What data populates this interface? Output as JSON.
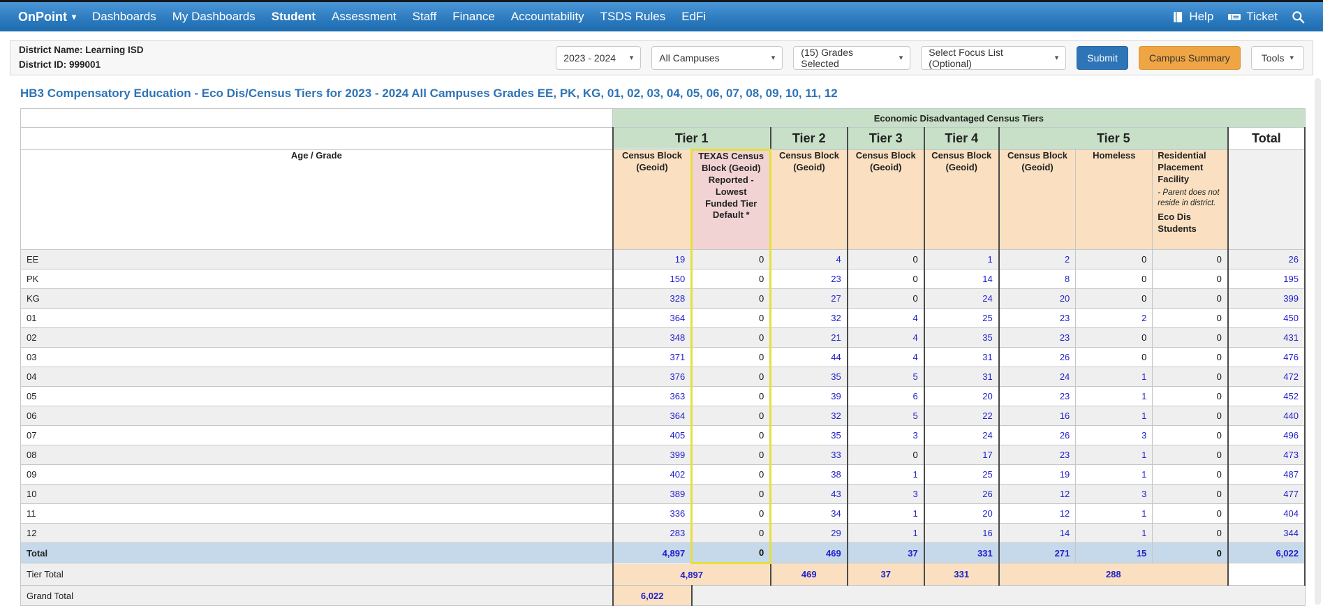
{
  "nav": {
    "brand": "OnPoint",
    "items": [
      {
        "label": "Dashboards",
        "active": false
      },
      {
        "label": "My Dashboards",
        "active": false
      },
      {
        "label": "Student",
        "active": true
      },
      {
        "label": "Assessment",
        "active": false
      },
      {
        "label": "Staff",
        "active": false
      },
      {
        "label": "Finance",
        "active": false
      },
      {
        "label": "Accountability",
        "active": false
      },
      {
        "label": "TSDS Rules",
        "active": false
      },
      {
        "label": "EdFi",
        "active": false
      }
    ],
    "help_label": "Help",
    "ticket_label": "Ticket"
  },
  "toolbar": {
    "district_name": "District Name: Learning ISD",
    "district_id": "District ID: 999001",
    "year_select": "2023 - 2024",
    "campus_select": "All Campuses",
    "grades_select": "(15) Grades Selected",
    "focus_select": "Select Focus List (Optional)",
    "submit_label": "Submit",
    "campus_summary_label": "Campus Summary",
    "tools_label": "Tools"
  },
  "page_title": "HB3 Compensatory Education - Eco Dis/Census Tiers for 2023 - 2024 All Campuses Grades EE, PK, KG, 01, 02, 03, 04, 05, 06, 07, 08, 09, 10, 11, 12",
  "table": {
    "banner": "Economic Disadvantaged Census Tiers",
    "age_grade_label": "Age / Grade",
    "tier_headers": [
      {
        "label": "Tier 1"
      },
      {
        "label": "Tier 2"
      },
      {
        "label": "Tier 3"
      },
      {
        "label": "Tier 4"
      },
      {
        "label": "Tier 5"
      },
      {
        "label": "Total"
      }
    ],
    "column_headers": {
      "census_block": "Census Block (Geoid)",
      "texas_census": "TEXAS Census Block (Geoid) Reported - Lowest Funded Tier Default *",
      "homeless": "Homeless",
      "residential_title": "Residential Placement Facility",
      "residential_note": "- Parent does not reside in district.",
      "residential_sub": "Eco Dis Students"
    },
    "rows": [
      {
        "label": "EE",
        "values": [
          "19",
          "0",
          "4",
          "0",
          "1",
          "2",
          "0",
          "0",
          "26"
        ]
      },
      {
        "label": "PK",
        "values": [
          "150",
          "0",
          "23",
          "0",
          "14",
          "8",
          "0",
          "0",
          "195"
        ]
      },
      {
        "label": "KG",
        "values": [
          "328",
          "0",
          "27",
          "0",
          "24",
          "20",
          "0",
          "0",
          "399"
        ]
      },
      {
        "label": "01",
        "values": [
          "364",
          "0",
          "32",
          "4",
          "25",
          "23",
          "2",
          "0",
          "450"
        ]
      },
      {
        "label": "02",
        "values": [
          "348",
          "0",
          "21",
          "4",
          "35",
          "23",
          "0",
          "0",
          "431"
        ]
      },
      {
        "label": "03",
        "values": [
          "371",
          "0",
          "44",
          "4",
          "31",
          "26",
          "0",
          "0",
          "476"
        ]
      },
      {
        "label": "04",
        "values": [
          "376",
          "0",
          "35",
          "5",
          "31",
          "24",
          "1",
          "0",
          "472"
        ]
      },
      {
        "label": "05",
        "values": [
          "363",
          "0",
          "39",
          "6",
          "20",
          "23",
          "1",
          "0",
          "452"
        ]
      },
      {
        "label": "06",
        "values": [
          "364",
          "0",
          "32",
          "5",
          "22",
          "16",
          "1",
          "0",
          "440"
        ]
      },
      {
        "label": "07",
        "values": [
          "405",
          "0",
          "35",
          "3",
          "24",
          "26",
          "3",
          "0",
          "496"
        ]
      },
      {
        "label": "08",
        "values": [
          "399",
          "0",
          "33",
          "0",
          "17",
          "23",
          "1",
          "0",
          "473"
        ]
      },
      {
        "label": "09",
        "values": [
          "402",
          "0",
          "38",
          "1",
          "25",
          "19",
          "1",
          "0",
          "487"
        ]
      },
      {
        "label": "10",
        "values": [
          "389",
          "0",
          "43",
          "3",
          "26",
          "12",
          "3",
          "0",
          "477"
        ]
      },
      {
        "label": "11",
        "values": [
          "336",
          "0",
          "34",
          "1",
          "20",
          "12",
          "1",
          "0",
          "404"
        ]
      },
      {
        "label": "12",
        "values": [
          "283",
          "0",
          "29",
          "1",
          "16",
          "14",
          "1",
          "0",
          "344"
        ]
      }
    ],
    "total_row": {
      "label": "Total",
      "values": [
        "4,897",
        "0",
        "469",
        "37",
        "331",
        "271",
        "15",
        "0",
        "6,022"
      ]
    },
    "tier_total_row": {
      "label": "Tier Total",
      "tier1": "4,897",
      "tier2": "469",
      "tier3": "37",
      "tier4": "331",
      "tier5": "288"
    },
    "grand_total_row": {
      "label": "Grand Total",
      "value": "6,022"
    }
  },
  "colors": {
    "navbar_blue": "#2e7cc0",
    "accent_blue": "#2e75b8",
    "campus_summary_orange": "#efa543",
    "header_green": "#c7e0c7",
    "header_peach": "#fae0c0",
    "highlight_pink": "#f2d3d3",
    "highlight_yellow": "#e6df3e",
    "total_row_blue": "#c6d9ea",
    "link_blue": "#2121cc",
    "title_blue": "#2e74b5"
  }
}
